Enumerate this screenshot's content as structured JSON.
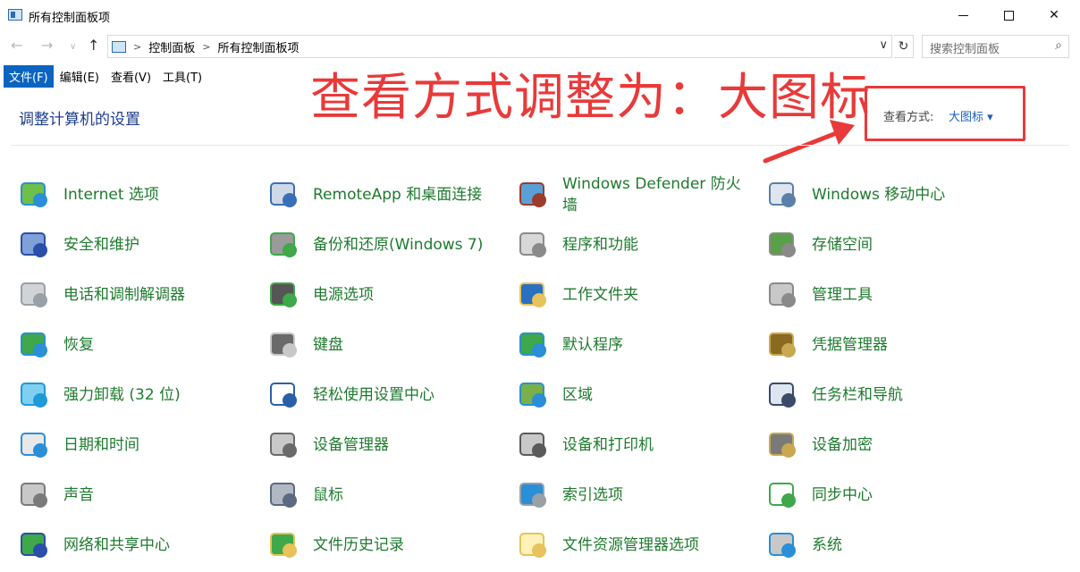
{
  "window": {
    "title": "所有控制面板项"
  },
  "address": {
    "crumbs": [
      "控制面板",
      "所有控制面板项"
    ],
    "search_placeholder": "搜索控制面板"
  },
  "menu": [
    "文件(F)",
    "编辑(E)",
    "查看(V)",
    "工具(T)"
  ],
  "header": {
    "title": "调整计算机的设置",
    "annotation": "查看方式调整为：大图标",
    "view_label": "查看方式:",
    "view_value": "大图标 ▾"
  },
  "colors": {
    "accent": "#0a64c0",
    "link_green": "#1e7a2e",
    "annotation_red": "#e83a3a",
    "title_blue": "#1e3c8c"
  },
  "items": [
    {
      "label": "Internet 选项",
      "icon": "globe-icon"
    },
    {
      "label": "RemoteApp 和桌面连接",
      "icon": "remote-desktop-icon"
    },
    {
      "label": "Windows Defender 防火墙",
      "icon": "firewall-icon"
    },
    {
      "label": "Windows 移动中心",
      "icon": "mobility-center-icon"
    },
    {
      "label": "安全和维护",
      "icon": "flag-icon"
    },
    {
      "label": "备份和还原(Windows 7)",
      "icon": "backup-icon"
    },
    {
      "label": "程序和功能",
      "icon": "programs-icon"
    },
    {
      "label": "存储空间",
      "icon": "storage-icon"
    },
    {
      "label": "电话和调制解调器",
      "icon": "phone-icon"
    },
    {
      "label": "电源选项",
      "icon": "battery-icon"
    },
    {
      "label": "工作文件夹",
      "icon": "work-folder-icon"
    },
    {
      "label": "管理工具",
      "icon": "admin-tools-icon"
    },
    {
      "label": "恢复",
      "icon": "recovery-icon"
    },
    {
      "label": "键盘",
      "icon": "keyboard-icon"
    },
    {
      "label": "默认程序",
      "icon": "default-programs-icon"
    },
    {
      "label": "凭据管理器",
      "icon": "credential-icon"
    },
    {
      "label": "强力卸载 (32 位)",
      "icon": "uninstall-icon"
    },
    {
      "label": "轻松使用设置中心",
      "icon": "ease-of-access-icon"
    },
    {
      "label": "区域",
      "icon": "region-icon"
    },
    {
      "label": "任务栏和导航",
      "icon": "taskbar-icon"
    },
    {
      "label": "日期和时间",
      "icon": "clock-icon"
    },
    {
      "label": "设备管理器",
      "icon": "device-manager-icon"
    },
    {
      "label": "设备和打印机",
      "icon": "printer-icon"
    },
    {
      "label": "设备加密",
      "icon": "encryption-icon"
    },
    {
      "label": "声音",
      "icon": "speaker-icon"
    },
    {
      "label": "鼠标",
      "icon": "mouse-icon"
    },
    {
      "label": "索引选项",
      "icon": "indexing-icon"
    },
    {
      "label": "同步中心",
      "icon": "sync-icon"
    },
    {
      "label": "网络和共享中心",
      "icon": "network-icon"
    },
    {
      "label": "文件历史记录",
      "icon": "file-history-icon"
    },
    {
      "label": "文件资源管理器选项",
      "icon": "explorer-options-icon"
    },
    {
      "label": "系统",
      "icon": "system-icon"
    }
  ]
}
